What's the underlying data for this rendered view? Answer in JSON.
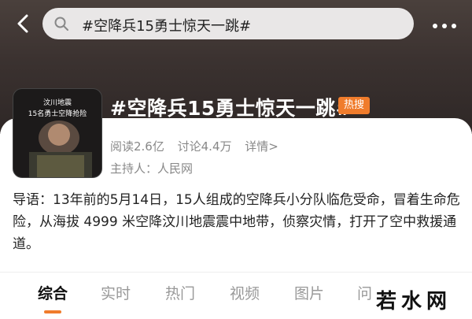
{
  "search": {
    "query": "#空降兵15勇士惊天一跳#"
  },
  "topic": {
    "title": "#空降兵15勇士惊天一跳#",
    "badge": "热搜",
    "reads": "阅读2.6亿",
    "discussions": "讨论4.4万",
    "details": "详情>",
    "host": "主持人：人民网",
    "thumbnail_caption_1": "汶川地震",
    "thumbnail_caption_2": "15名勇士空降抢险"
  },
  "intro": "导语：13年前的5月14日，15人组成的空降兵小分队临危受命，冒着生命危险，从海拔 4999 米空降汶川地震震中地带，侦察灾情，打开了空中救援通道。",
  "tabs": [
    "综合",
    "实时",
    "热门",
    "视频",
    "图片",
    "问"
  ],
  "watermark": "若水网",
  "colors": {
    "accent": "#f07c2c",
    "header": "#3b3230"
  },
  "icons": {
    "back": "chevron-left-icon",
    "search": "search-icon",
    "more": "more-dots-icon"
  }
}
